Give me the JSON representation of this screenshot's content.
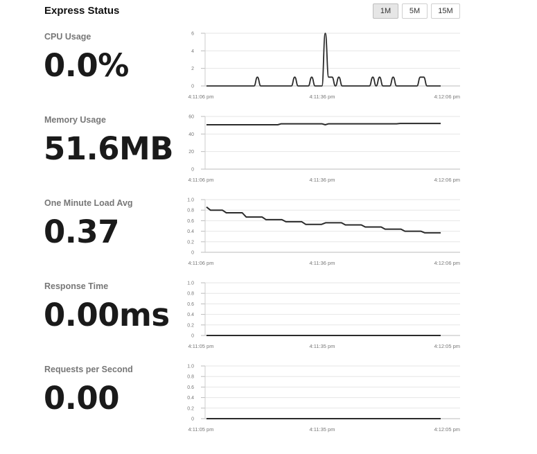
{
  "header": {
    "title": "Express Status"
  },
  "range_buttons": [
    {
      "label": "1M",
      "active": true
    },
    {
      "label": "5M",
      "active": false
    },
    {
      "label": "15M",
      "active": false
    }
  ],
  "metrics": [
    {
      "label": "CPU Usage",
      "value": "0.0%"
    },
    {
      "label": "Memory Usage",
      "value": "51.6MB"
    },
    {
      "label": "One Minute Load Avg",
      "value": "0.37"
    },
    {
      "label": "Response Time",
      "value": "0.00ms"
    },
    {
      "label": "Requests per Second",
      "value": "0.00"
    }
  ],
  "colors": {
    "line": "#2a2a2a",
    "grid": "#e6e6e6",
    "tick": "#888888"
  },
  "chart_data": [
    {
      "type": "line",
      "yticks": [
        "0",
        "2",
        "4",
        "6"
      ],
      "ylim": [
        0,
        6
      ],
      "xticks": [
        "4:11:06 pm",
        "4:11:36 pm",
        "4:12:06 pm"
      ],
      "series": [
        {
          "values": [
            0,
            0,
            0,
            0,
            0,
            0,
            0,
            0,
            0,
            0,
            0,
            0,
            0,
            0,
            0,
            1,
            0,
            0,
            0,
            0,
            0,
            0,
            0,
            0,
            0,
            0,
            1,
            0,
            0,
            0,
            0,
            1,
            0,
            0,
            0,
            6,
            1,
            1,
            0,
            1,
            0,
            0,
            0,
            0,
            0,
            0,
            0,
            0,
            0,
            1,
            0,
            1,
            0,
            0,
            0,
            1,
            0,
            0,
            0,
            0,
            0,
            0,
            0,
            1,
            1,
            0,
            0,
            0,
            0,
            0
          ]
        }
      ]
    },
    {
      "type": "line",
      "yticks": [
        "0",
        "20",
        "40",
        "60"
      ],
      "ylim": [
        0,
        60
      ],
      "xticks": [
        "4:11:06 pm",
        "4:11:36 pm",
        "4:12:06 pm"
      ],
      "series": [
        {
          "values": [
            50.5,
            50.5,
            50.5,
            50.5,
            50.5,
            50.5,
            50.5,
            50.5,
            50.5,
            50.5,
            50.5,
            50.5,
            50.5,
            50.5,
            50.5,
            50.5,
            50.5,
            50.5,
            50.5,
            50.5,
            50.5,
            50.5,
            51.6,
            51.6,
            51.6,
            51.6,
            51.6,
            51.6,
            51.6,
            51.6,
            51.6,
            51.6,
            51.6,
            51.6,
            51.6,
            50.5,
            51.6,
            51.6,
            51.6,
            51.6,
            51.6,
            51.6,
            51.6,
            51.6,
            51.6,
            51.6,
            51.6,
            51.6,
            51.6,
            51.6,
            51.6,
            51.6,
            51.6,
            51.6,
            51.6,
            51.6,
            51.6,
            52.0,
            52.0,
            52.0,
            52.0,
            52.0,
            52.0,
            52.0,
            52.0,
            52.0,
            52.0,
            52.0,
            52.0,
            52.0
          ]
        }
      ]
    },
    {
      "type": "line",
      "yticks": [
        "0",
        "0.2",
        "0.4",
        "0.6",
        "0.8",
        "1.0"
      ],
      "ylim": [
        0,
        1
      ],
      "xticks": [
        "4:11:06 pm",
        "4:11:36 pm",
        "4:12:06 pm"
      ],
      "series": [
        {
          "values": [
            0.86,
            0.8,
            0.8,
            0.8,
            0.8,
            0.75,
            0.75,
            0.75,
            0.75,
            0.75,
            0.67,
            0.67,
            0.67,
            0.67,
            0.67,
            0.62,
            0.62,
            0.62,
            0.62,
            0.62,
            0.58,
            0.58,
            0.58,
            0.58,
            0.58,
            0.53,
            0.53,
            0.53,
            0.53,
            0.53,
            0.56,
            0.56,
            0.56,
            0.56,
            0.56,
            0.52,
            0.52,
            0.52,
            0.52,
            0.52,
            0.48,
            0.48,
            0.48,
            0.48,
            0.48,
            0.44,
            0.44,
            0.44,
            0.44,
            0.44,
            0.4,
            0.4,
            0.4,
            0.4,
            0.4,
            0.37,
            0.37,
            0.37,
            0.37,
            0.37
          ]
        }
      ]
    },
    {
      "type": "line",
      "yticks": [
        "0",
        "0.2",
        "0.4",
        "0.6",
        "0.8",
        "1.0"
      ],
      "ylim": [
        0,
        1
      ],
      "xticks": [
        "4:11:05 pm",
        "4:11:35 pm",
        "4:12:05 pm"
      ],
      "series": [
        {
          "values": [
            0,
            0,
            0,
            0,
            0,
            0,
            0,
            0,
            0,
            0,
            0,
            0,
            0,
            0,
            0,
            0,
            0,
            0,
            0,
            0,
            0,
            0,
            0,
            0,
            0,
            0,
            0,
            0,
            0,
            0,
            0,
            0,
            0,
            0,
            0,
            0,
            0,
            0,
            0,
            0,
            0,
            0,
            0,
            0,
            0,
            0,
            0,
            0,
            0,
            0,
            0,
            0,
            0,
            0,
            0,
            0,
            0,
            0,
            0,
            0
          ]
        }
      ]
    },
    {
      "type": "line",
      "yticks": [
        "0",
        "0.2",
        "0.4",
        "0.6",
        "0.8",
        "1.0"
      ],
      "ylim": [
        0,
        1
      ],
      "xticks": [
        "4:11:05 pm",
        "4:11:35 pm",
        "4:12:05 pm"
      ],
      "series": [
        {
          "values": [
            0,
            0,
            0,
            0,
            0,
            0,
            0,
            0,
            0,
            0,
            0,
            0,
            0,
            0,
            0,
            0,
            0,
            0,
            0,
            0,
            0,
            0,
            0,
            0,
            0,
            0,
            0,
            0,
            0,
            0,
            0,
            0,
            0,
            0,
            0,
            0,
            0,
            0,
            0,
            0,
            0,
            0,
            0,
            0,
            0,
            0,
            0,
            0,
            0,
            0,
            0,
            0,
            0,
            0,
            0,
            0,
            0,
            0,
            0,
            0
          ]
        }
      ]
    }
  ]
}
